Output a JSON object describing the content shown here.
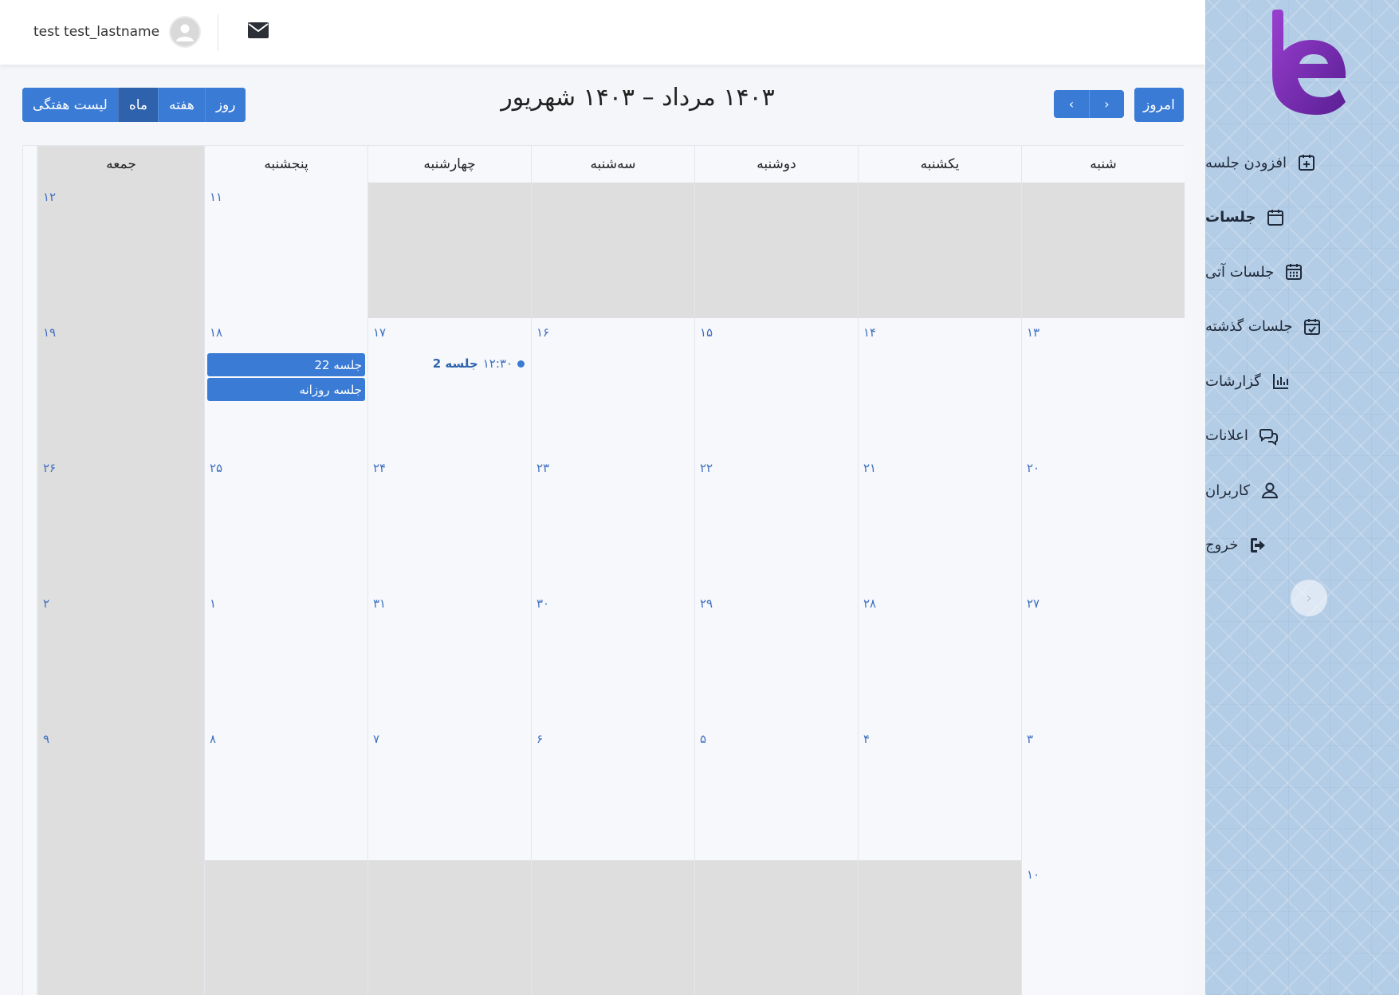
{
  "user": {
    "name": "test test_lastname"
  },
  "sidebar": {
    "items": [
      {
        "label": "افزودن جلسه",
        "icon": "calendar-plus-icon",
        "active": false
      },
      {
        "label": "جلسات",
        "icon": "calendar-icon",
        "active": true
      },
      {
        "label": "جلسات آتی",
        "icon": "calendar-grid-icon",
        "active": false
      },
      {
        "label": "جلسات گذشته",
        "icon": "calendar-check-icon",
        "active": false
      },
      {
        "label": "گزارشات",
        "icon": "bar-chart-icon",
        "active": false
      },
      {
        "label": "اعلانات",
        "icon": "chat-bubbles-icon",
        "active": false
      },
      {
        "label": "کاربران",
        "icon": "user-icon",
        "active": false
      },
      {
        "label": "خروج",
        "icon": "sign-out-icon",
        "active": false
      }
    ],
    "collapse_glyph": "›"
  },
  "toolbar": {
    "views": [
      {
        "label": "لیست هفتگی",
        "active": false
      },
      {
        "label": "ماه",
        "active": true
      },
      {
        "label": "هفته",
        "active": false
      },
      {
        "label": "روز",
        "active": false
      }
    ],
    "title": "۱۴۰۳ مرداد – ۱۴۰۳ شهریور",
    "prev_glyph": "‹",
    "next_glyph": "›",
    "today_label": "امروز"
  },
  "calendar": {
    "weekdays": [
      "شنبه",
      "یکشنبه",
      "دوشنبه",
      "سه‌شنبه",
      "چهارشنبه",
      "پنجشنبه",
      "جمعه"
    ],
    "weeks": [
      {
        "days": [
          {
            "num": "",
            "off": true
          },
          {
            "num": "",
            "off": true
          },
          {
            "num": "",
            "off": true
          },
          {
            "num": "",
            "off": true
          },
          {
            "num": "",
            "off": true
          },
          {
            "num": "۱۱",
            "off": false
          },
          {
            "num": "۱۲",
            "off": true
          }
        ]
      },
      {
        "days": [
          {
            "num": "۱۳",
            "off": false
          },
          {
            "num": "۱۴",
            "off": false
          },
          {
            "num": "۱۵",
            "off": false
          },
          {
            "num": "۱۶",
            "off": false
          },
          {
            "num": "۱۷",
            "off": false
          },
          {
            "num": "۱۸",
            "off": false
          },
          {
            "num": "۱۹",
            "off": true
          }
        ]
      },
      {
        "days": [
          {
            "num": "۲۰",
            "off": false
          },
          {
            "num": "۲۱",
            "off": false
          },
          {
            "num": "۲۲",
            "off": false
          },
          {
            "num": "۲۳",
            "off": false
          },
          {
            "num": "۲۴",
            "off": false
          },
          {
            "num": "۲۵",
            "off": false
          },
          {
            "num": "۲۶",
            "off": true
          }
        ]
      },
      {
        "days": [
          {
            "num": "۲۷",
            "off": false
          },
          {
            "num": "۲۸",
            "off": false
          },
          {
            "num": "۲۹",
            "off": false
          },
          {
            "num": "۳۰",
            "off": false
          },
          {
            "num": "۳۱",
            "off": false
          },
          {
            "num": "۱",
            "off": false
          },
          {
            "num": "۲",
            "off": true
          }
        ]
      },
      {
        "days": [
          {
            "num": "۳",
            "off": false
          },
          {
            "num": "۴",
            "off": false
          },
          {
            "num": "۵",
            "off": false
          },
          {
            "num": "۶",
            "off": false
          },
          {
            "num": "۷",
            "off": false
          },
          {
            "num": "۸",
            "off": false
          },
          {
            "num": "۹",
            "off": true
          }
        ]
      },
      {
        "days": [
          {
            "num": "۱۰",
            "off": false
          },
          {
            "num": "",
            "off": true
          },
          {
            "num": "",
            "off": true
          },
          {
            "num": "",
            "off": true
          },
          {
            "num": "",
            "off": true
          },
          {
            "num": "",
            "off": true
          },
          {
            "num": "",
            "off": true
          }
        ]
      }
    ],
    "events": {
      "thursday_18": [
        "جلسه 22",
        "جلسه روزانه"
      ],
      "wednesday_17": {
        "time": "۱۲:۳۰",
        "title": "جلسه 2"
      }
    }
  },
  "colors": {
    "accent": "#3a7bd5",
    "accent_dark": "#2f62ad",
    "off_day": "#dedede",
    "sidebar_bg": "#b4cde6",
    "logo": "#7b2fb5"
  }
}
